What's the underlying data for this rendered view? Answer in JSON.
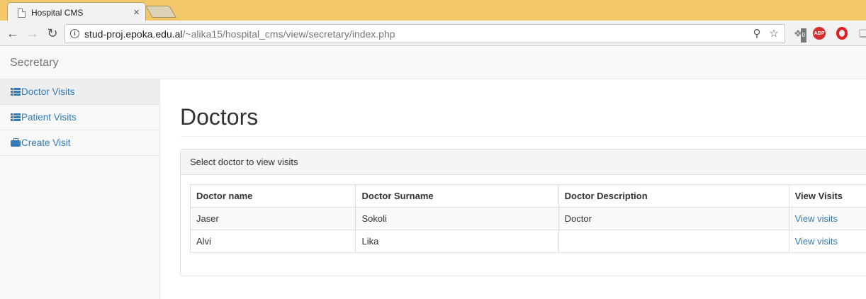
{
  "browser": {
    "tab_title": "Hospital CMS",
    "url_host": "stud-proj.epoka.edu.al",
    "url_path": "/~alika15/hospital_cms/view/secretary/index.php",
    "extensions": {
      "badge_count": "0",
      "abp_label": "ABP"
    }
  },
  "navbar": {
    "brand": "Secretary"
  },
  "sidebar": {
    "items": [
      {
        "label": "Doctor Visits",
        "icon": "list-icon",
        "active": true
      },
      {
        "label": "Patient Visits",
        "icon": "list-icon",
        "active": false
      },
      {
        "label": "Create Visit",
        "icon": "briefcase-icon",
        "active": false
      }
    ]
  },
  "main": {
    "title": "Doctors",
    "panel_heading": "Select doctor to view visits",
    "table": {
      "headers": [
        "Doctor name",
        "Doctor Surname",
        "Doctor Description",
        "View Visits"
      ],
      "rows": [
        {
          "name": "Jaser",
          "surname": "Sokoli",
          "description": "Doctor",
          "action": "View visits"
        },
        {
          "name": "Alvi",
          "surname": "Lika",
          "description": "",
          "action": "View visits"
        }
      ]
    }
  },
  "colors": {
    "link": "#337ab7",
    "tabstrip": "#f2c86a"
  }
}
